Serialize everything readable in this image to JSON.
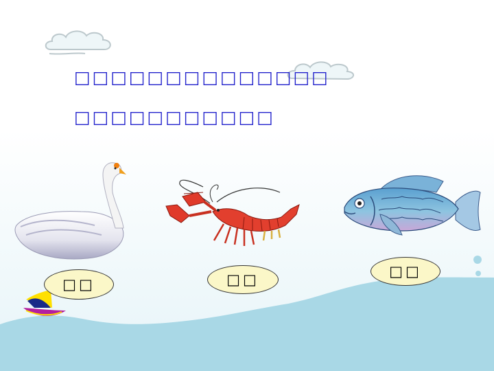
{
  "slide": {
    "line1": "□□□□□□□□□□□□□□",
    "line2": "□□□□□□□□□□□"
  },
  "animals": [
    {
      "name": "swan",
      "label": "□□"
    },
    {
      "name": "crayfish",
      "label": "□□"
    },
    {
      "name": "fish",
      "label": "□□"
    }
  ],
  "colors": {
    "text": "#2222cc",
    "water": "#a9d8e6",
    "label_fill": "#fbf7c8",
    "sky_gradient_bottom": "#eef8fb"
  }
}
